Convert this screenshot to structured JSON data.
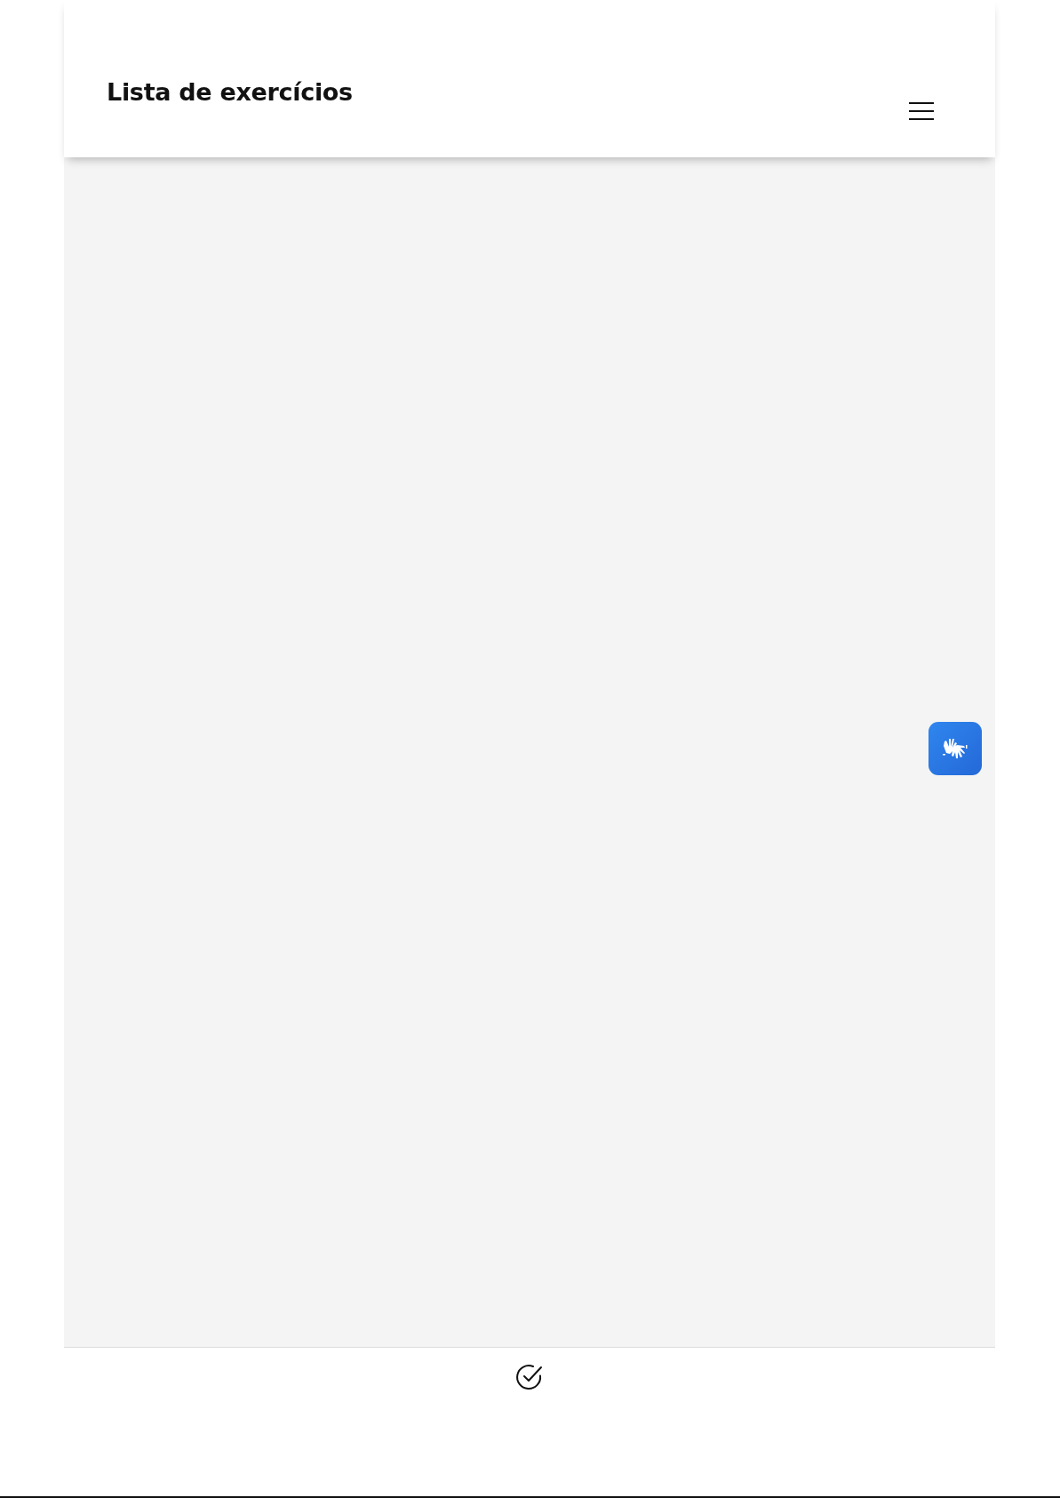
{
  "header": {
    "title": "Lista de exercícios"
  }
}
